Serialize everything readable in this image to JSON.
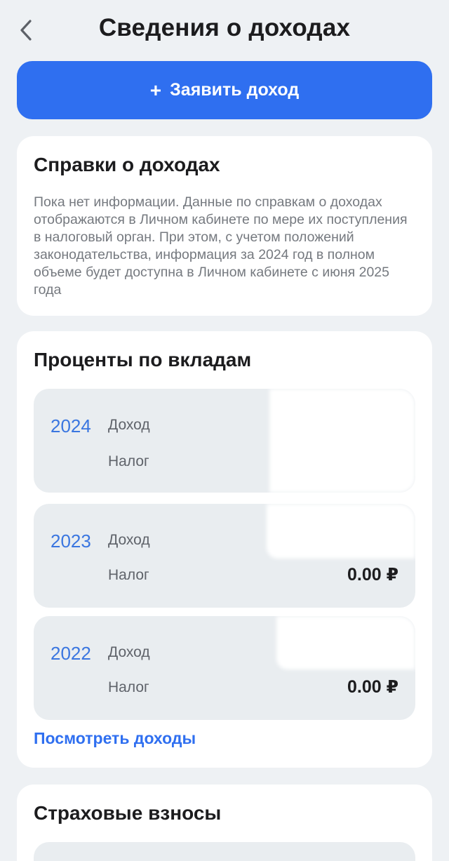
{
  "header": {
    "title": "Сведения о доходах",
    "back_icon": "chevron-left-icon"
  },
  "primary_action": {
    "plus": "+",
    "label": "Заявить доход",
    "color": "#2f6ff0"
  },
  "certificates": {
    "title": "Справки о доходах",
    "text": "Пока нет информации. Данные по справкам о доходах отображаются в Личном кабинете по мере их поступления в налоговый орган. При этом, с учетом положений законодательства, информация за 2024 год в полном объеме будет доступна в Личном кабинете с июня 2025 года"
  },
  "deposits": {
    "title": "Проценты по вкладам",
    "rows": [
      {
        "year": "2024",
        "income_label": "Доход",
        "tax_label": "Налог",
        "tax_value": ""
      },
      {
        "year": "2023",
        "income_label": "Доход",
        "tax_label": "Налог",
        "tax_value": "0.00 ₽"
      },
      {
        "year": "2022",
        "income_label": "Доход",
        "tax_label": "Налог",
        "tax_value": "0.00 ₽"
      }
    ],
    "link": "Посмотреть доходы"
  },
  "insurance": {
    "title": "Страховые взносы"
  }
}
